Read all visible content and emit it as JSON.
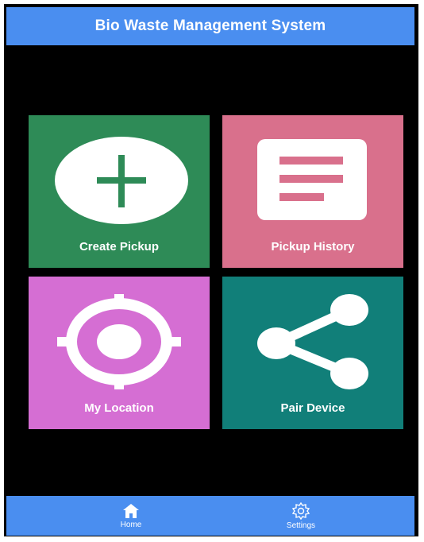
{
  "app": {
    "title": "Bio Waste Management System"
  },
  "tiles": [
    {
      "label": "Create Pickup",
      "color": "#2e8b57",
      "icon": "plus-circle-icon"
    },
    {
      "label": "Pickup History",
      "color": "#d9708c",
      "icon": "list-doc-icon"
    },
    {
      "label": "My Location",
      "color": "#d56ed3",
      "icon": "location-target-icon"
    },
    {
      "label": "Pair Device",
      "color": "#117f79",
      "icon": "share-icon"
    }
  ],
  "bottom_nav": [
    {
      "label": "Home",
      "icon": "home-icon"
    },
    {
      "label": "Settings",
      "icon": "gear-icon"
    }
  ],
  "colors": {
    "bar": "#4a8ef0",
    "background": "#000000"
  }
}
